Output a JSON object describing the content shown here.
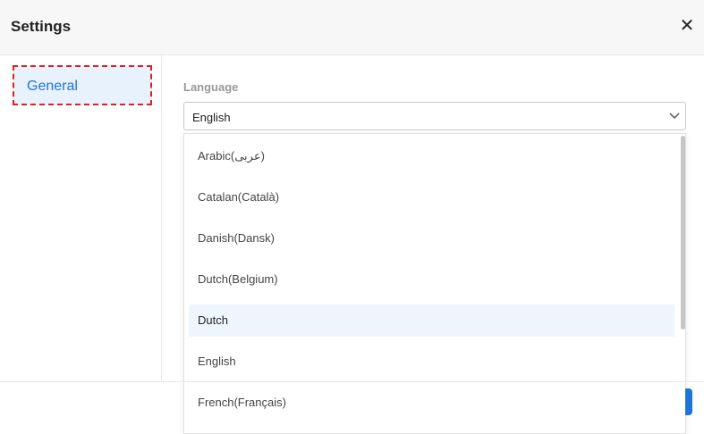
{
  "dialog": {
    "title": "Settings",
    "close_symbol": "✕"
  },
  "sidebar": {
    "items": [
      {
        "label": "General",
        "active": true
      }
    ]
  },
  "language": {
    "label": "Language",
    "selected": "English",
    "options": [
      "Arabic(عربى)",
      "Catalan(Català)",
      "Danish(Dansk)",
      "Dutch(Belgium)",
      "Dutch",
      "English",
      "French(Français)"
    ],
    "highlighted": "Dutch"
  },
  "colors": {
    "accent": "#1f74d8",
    "highlight_bg": "#edf5fd",
    "annotation": "#e02020"
  }
}
